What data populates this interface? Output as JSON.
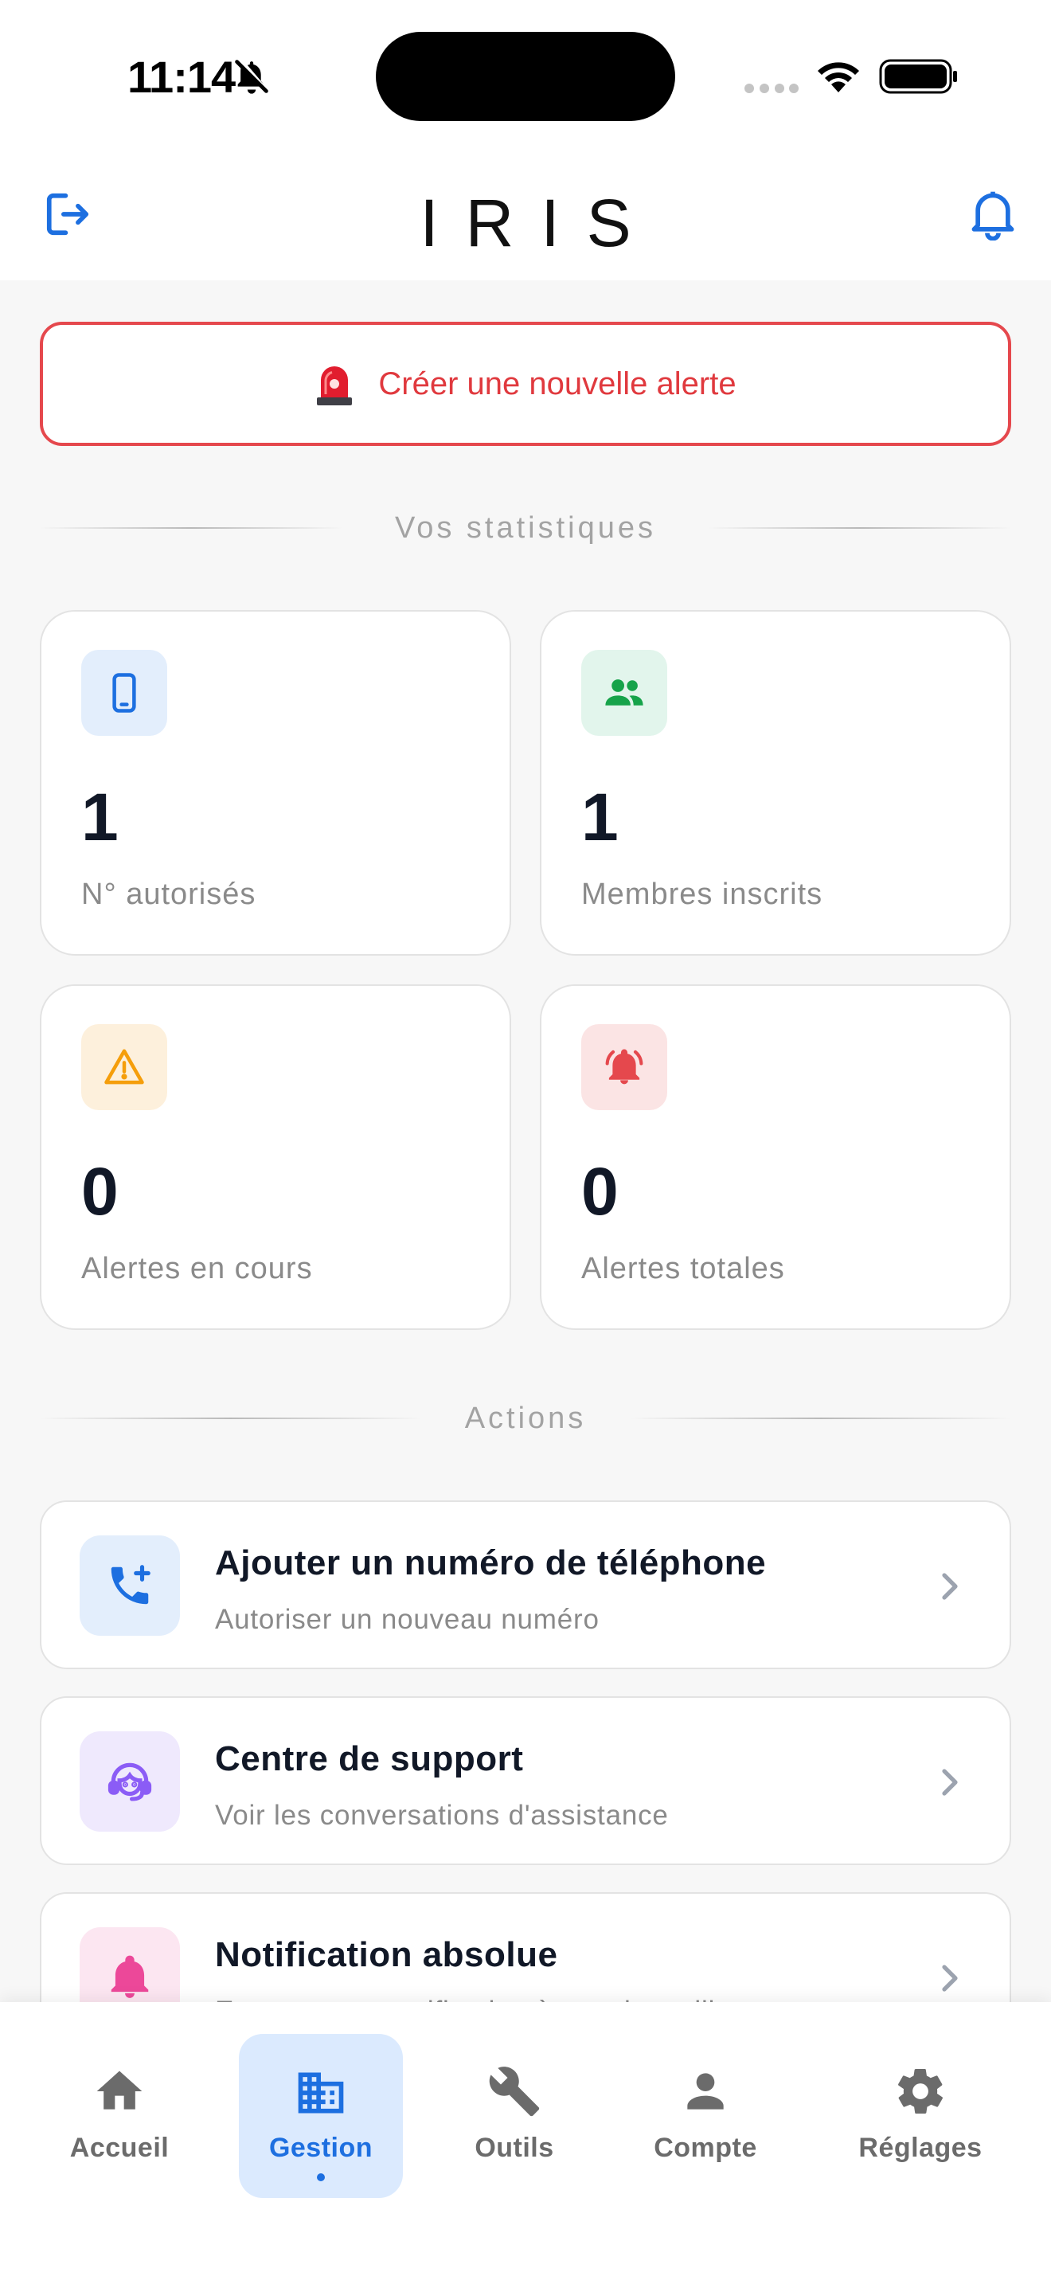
{
  "status_bar": {
    "time": "11:14"
  },
  "header": {
    "title": "IRIS"
  },
  "alert_button": {
    "label": "Créer une nouvelle alerte"
  },
  "stats_section": {
    "title": "Vos statistiques",
    "cards": [
      {
        "value": "1",
        "label": "N° autorisés",
        "icon": "phone-icon",
        "color": "#1d6fe0",
        "bg": "#e3eefc"
      },
      {
        "value": "1",
        "label": "Membres inscrits",
        "icon": "group-icon",
        "color": "#16a34a",
        "bg": "#e2f5ec"
      },
      {
        "value": "0",
        "label": "Alertes en cours",
        "icon": "warning-icon",
        "color": "#f59e0b",
        "bg": "#fdf0dc"
      },
      {
        "value": "0",
        "label": "Alertes totales",
        "icon": "ringing-bell-icon",
        "color": "#e5484d",
        "bg": "#fbe4e4"
      }
    ]
  },
  "actions_section": {
    "title": "Actions",
    "items": [
      {
        "title": "Ajouter un numéro de téléphone",
        "subtitle": "Autoriser un nouveau numéro",
        "icon": "add-call-icon",
        "color": "#1d6fe0",
        "bg": "#e3eefc"
      },
      {
        "title": "Centre de support",
        "subtitle": "Voir les conversations d'assistance",
        "icon": "support-agent-icon",
        "color": "#8b5cf6",
        "bg": "#efe9fd"
      },
      {
        "title": "Notification absolue",
        "subtitle": "Envoyer une notification à tous les utilisateurs",
        "icon": "bell-icon",
        "color": "#ec4899",
        "bg": "#fce6f1"
      }
    ]
  },
  "bottom_nav": {
    "items": [
      {
        "label": "Accueil",
        "icon": "home-icon"
      },
      {
        "label": "Gestion",
        "icon": "building-icon",
        "active": true
      },
      {
        "label": "Outils",
        "icon": "wrench-icon"
      },
      {
        "label": "Compte",
        "icon": "person-icon"
      },
      {
        "label": "Réglages",
        "icon": "gear-icon"
      }
    ]
  },
  "colors": {
    "accent": "#1d6fe0",
    "danger": "#e5484d"
  }
}
